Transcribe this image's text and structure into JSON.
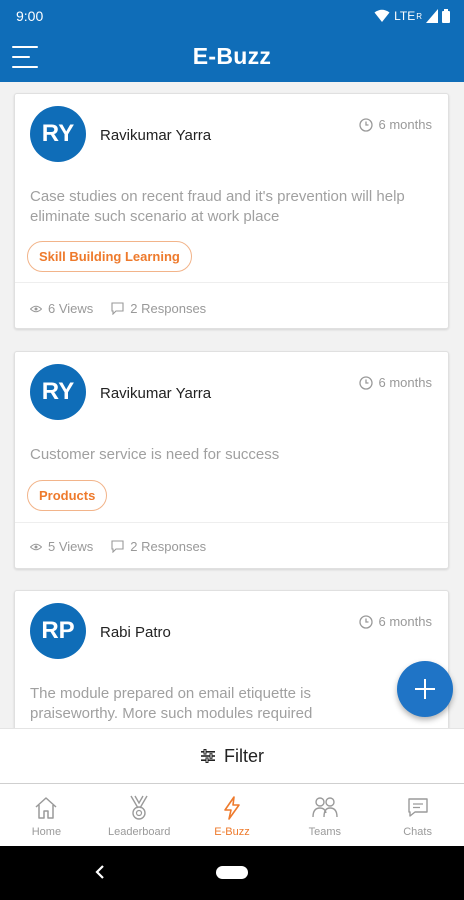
{
  "status_bar": {
    "time": "9:00",
    "network": "LTE",
    "roaming": "R"
  },
  "app_bar": {
    "title": "E-Buzz",
    "menu_icon": "hamburger-menu-icon"
  },
  "posts": [
    {
      "initials": "RY",
      "author": "Ravikumar Yarra",
      "time": "6 months",
      "text": "Case studies on recent fraud and it's prevention will help eliminate such scenario at work place",
      "tag": "Skill Building Learning",
      "views": "6 Views",
      "responses": "2 Responses"
    },
    {
      "initials": "RY",
      "author": "Ravikumar Yarra",
      "time": "6 months",
      "text": "Customer service is need for success",
      "tag": "Products",
      "views": "5 Views",
      "responses": "2 Responses"
    },
    {
      "initials": "RP",
      "author": "Rabi Patro",
      "time": "6 months",
      "text": "The module prepared on email etiquette is praiseworthy. More such modules required"
    }
  ],
  "fab": {
    "icon": "plus-icon"
  },
  "filter": {
    "label": "Filter",
    "icon": "filter-sliders-icon"
  },
  "bottom_nav": [
    {
      "label": "Home",
      "icon": "home-icon",
      "active": false
    },
    {
      "label": "Leaderboard",
      "icon": "medal-icon",
      "active": false
    },
    {
      "label": "E-Buzz",
      "icon": "lightning-icon",
      "active": true
    },
    {
      "label": "Teams",
      "icon": "people-icon",
      "active": false
    },
    {
      "label": "Chats",
      "icon": "chat-icon",
      "active": false
    }
  ],
  "colors": {
    "primary": "#0f6db8",
    "accent": "#ee7a2c",
    "muted_text": "#999999"
  }
}
